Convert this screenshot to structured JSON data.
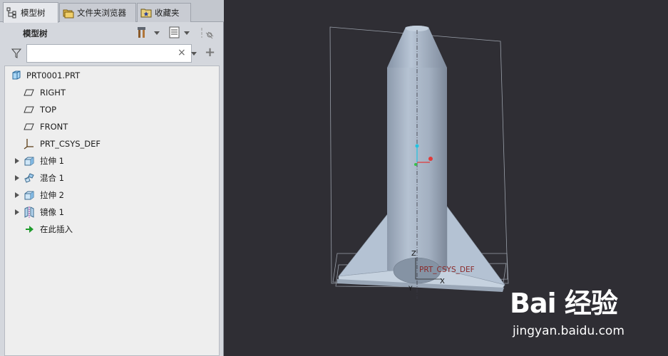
{
  "tabs": [
    {
      "label": "模型树",
      "icon": "model-tree-icon",
      "active": true
    },
    {
      "label": "文件夹浏览器",
      "icon": "folder-browser-icon",
      "active": false
    },
    {
      "label": "收藏夹",
      "icon": "favorites-icon",
      "active": false
    }
  ],
  "tree_header": {
    "title": "模型树"
  },
  "search": {
    "value": "",
    "clear_glyph": "×",
    "add_glyph": "+"
  },
  "tree": {
    "root": {
      "label": "PRT0001.PRT",
      "icon": "part-icon"
    },
    "items": [
      {
        "label": "RIGHT",
        "icon": "datum-plane-icon",
        "expandable": false
      },
      {
        "label": "TOP",
        "icon": "datum-plane-icon",
        "expandable": false
      },
      {
        "label": "FRONT",
        "icon": "datum-plane-icon",
        "expandable": false
      },
      {
        "label": "PRT_CSYS_DEF",
        "icon": "coordinate-system-icon",
        "expandable": false
      },
      {
        "label": "拉伸 1",
        "icon": "extrude-icon",
        "expandable": true
      },
      {
        "label": "混合 1",
        "icon": "blend-icon",
        "expandable": true
      },
      {
        "label": "拉伸 2",
        "icon": "extrude-icon",
        "expandable": true
      },
      {
        "label": "镜像 1",
        "icon": "mirror-icon",
        "expandable": true
      },
      {
        "label": "在此插入",
        "icon": "insert-here-arrow-icon",
        "expandable": false
      }
    ]
  },
  "viewport": {
    "axis_z_label": "Z",
    "axis_x_label": "X",
    "axis_y_label": "Y",
    "csys_label": "PRT_CSYS_DEF",
    "background_color": "#2f2e34",
    "model_color": "#a9b6c6"
  },
  "watermark": {
    "logo": "Bai 经验",
    "url": "jingyan.baidu.com"
  }
}
